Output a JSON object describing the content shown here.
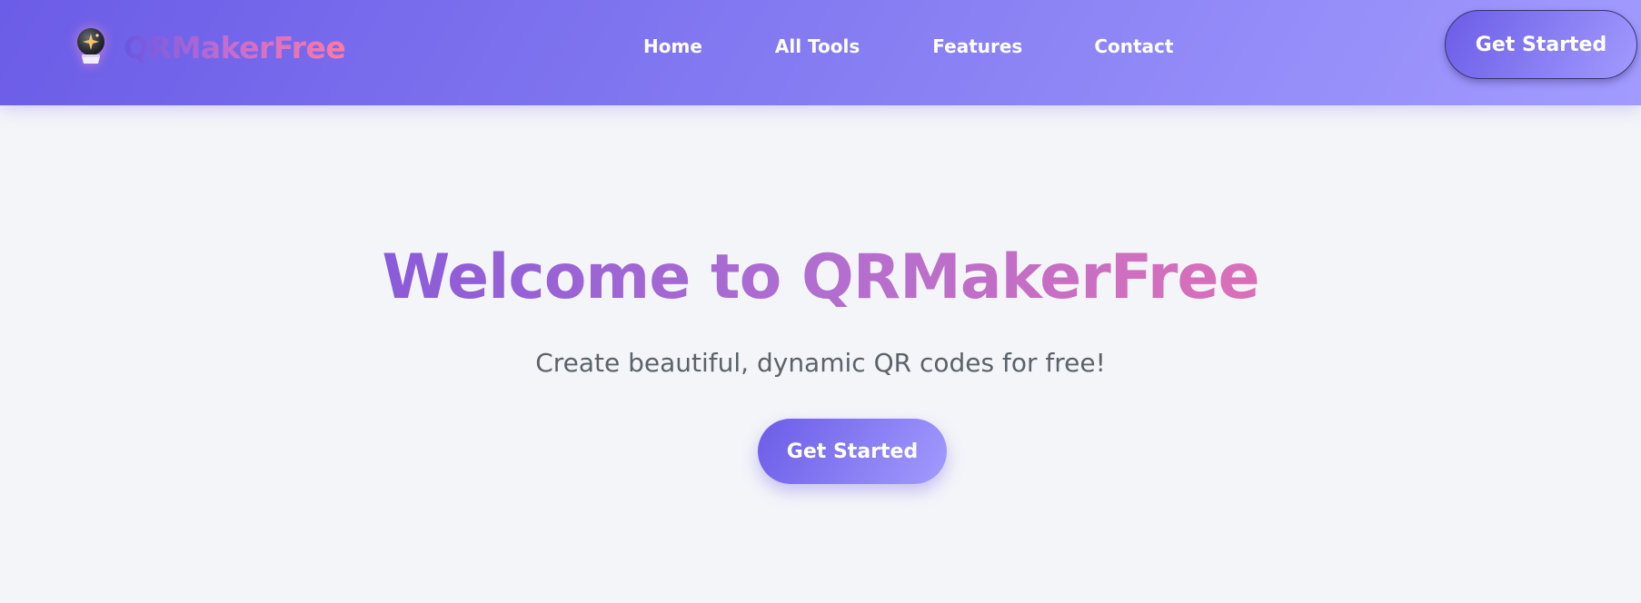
{
  "brand": {
    "icon": "crystal-ball-icon",
    "name": "QRMakerFree"
  },
  "nav": {
    "links": [
      {
        "label": "Home"
      },
      {
        "label": "All Tools"
      },
      {
        "label": "Features"
      },
      {
        "label": "Contact"
      }
    ],
    "cta_label": "Get Started"
  },
  "hero": {
    "title": "Welcome to QRMakerFree",
    "subtitle": "Create beautiful, dynamic QR codes for free!",
    "cta_label": "Get Started"
  },
  "colors": {
    "primary": "#6c5ce7",
    "primary_light": "#a29bfe",
    "accent_pink": "#ff7aa3",
    "background": "#f4f5f9",
    "subtitle_text": "#5a626a"
  }
}
